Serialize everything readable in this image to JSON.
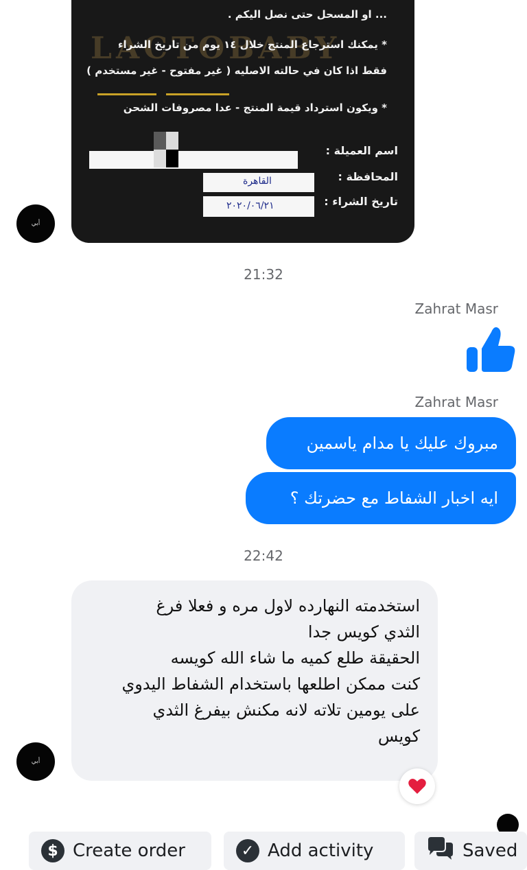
{
  "photo": {
    "top_line": "... او المسحل حتى نصل اليكم .",
    "watermark": "LACTOBABY",
    "line1": "* يمكنك استرجاع المنتج خلال ١٤ يوم من تاريخ الشراء",
    "line2": "فقط اذا كان في حالته الاصليه ( غير مفتوح - غير مستخدم )",
    "line3": "* ويكون استرداد قيمة المنتج - عدا مصروفات الشحن",
    "customer_label": "اسم العميلة :",
    "governorate_label": "المحافظة :",
    "governorate_value": "القاهرة",
    "date_label": "تاريخ الشراء :",
    "date_value": "٢٠٢٠/٠٦/٢١"
  },
  "avatar_text": "أبي",
  "time1": "21:32",
  "sender1": "Zahrat Masr",
  "sender2": "Zahrat Masr",
  "msg_out_1": "مبروك عليك يا مدام ياسمين",
  "msg_out_2": "ايه اخبار الشفاط مع حضرتك ؟",
  "time2": "22:42",
  "msg_in_lines": [
    "استخدمته النهارده لاول مره و فعلا فرغ",
    "الثدي كويس جدا",
    "الحقيقة طلع كميه ما شاء الله كويسه",
    "كنت ممكن اطلعها باستخدام الشفاط اليدوي",
    "على يومين تلاته لانه مكنش بيفرغ الثدي",
    "كويس"
  ],
  "reaction": "heart-reaction",
  "actions": {
    "create_order": "Create order",
    "add_activity": "Add activity",
    "saved": "Saved"
  },
  "colors": {
    "outgoing_bubble": "#0a7cff",
    "incoming_bubble": "#f0f1f4",
    "like_thumb": "#0a7cff",
    "heart": "#e41e3f"
  }
}
